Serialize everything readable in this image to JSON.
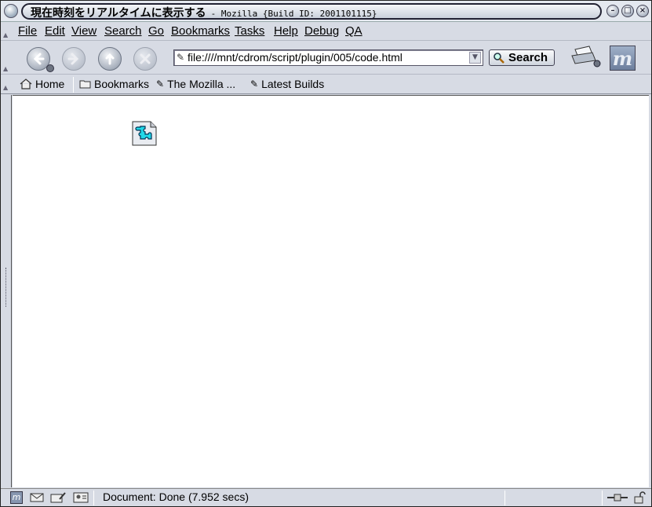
{
  "window": {
    "title_main": "現在時刻をリアルタイムに表示する",
    "title_sub": "- Mozilla {Build ID: 2001101115}"
  },
  "menubar": {
    "items": [
      "File",
      "Edit",
      "View",
      "Search",
      "Go",
      "Bookmarks",
      "Tasks",
      "Help",
      "Debug",
      "QA"
    ]
  },
  "navigation": {
    "url": "file:////mnt/cdrom/script/plugin/005/code.html",
    "search_label": "Search"
  },
  "personal_toolbar": {
    "items": [
      "Home",
      "Bookmarks",
      "The Mozilla ...",
      "Latest Builds"
    ]
  },
  "status": {
    "text": "Document: Done (7.952 secs)"
  }
}
